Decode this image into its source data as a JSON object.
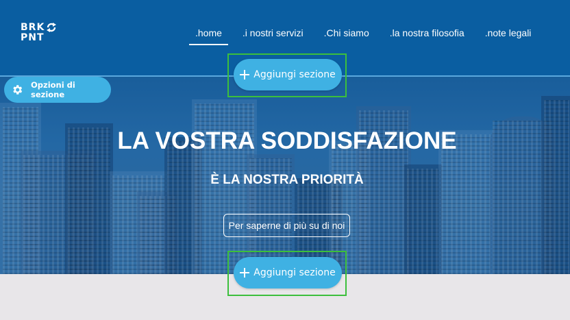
{
  "logo": {
    "line1": "BRK",
    "line2": "PNT"
  },
  "nav": {
    "items": [
      {
        "label": ".home",
        "active": true
      },
      {
        "label": ".i nostri servizi",
        "active": false
      },
      {
        "label": ".Chi siamo",
        "active": false
      },
      {
        "label": ".la nostra filosofia",
        "active": false
      },
      {
        "label": ".note legali",
        "active": false
      }
    ]
  },
  "editor": {
    "add_section_label": "Aggiungi sezione",
    "section_options_label": "Opzioni di sezione",
    "accent_color": "#3fb1e3",
    "highlight_color": "#3cbf3c"
  },
  "hero": {
    "title": "LA VOSTRA SODDISFAZIONE",
    "subtitle": "È LA NOSTRA PRIORITÀ",
    "button_label": "Per saperne di più su di noi"
  },
  "colors": {
    "header_bg": "#0a5ea1",
    "lower_bg": "#e8e6e9"
  }
}
